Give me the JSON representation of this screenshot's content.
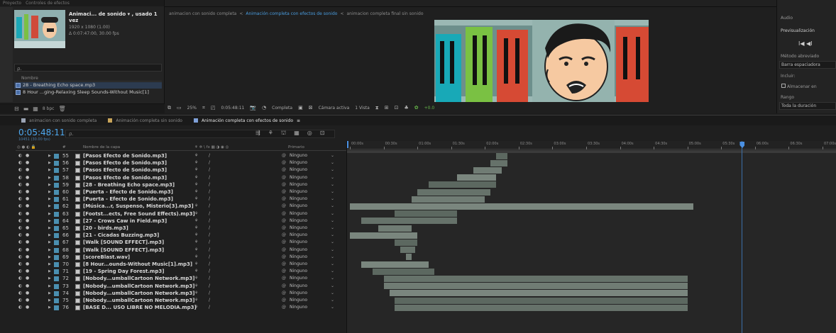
{
  "project": {
    "tabs": [
      "Proyecto",
      "Controles de efectos"
    ],
    "comp_name": "Animaci... de sonido ▾ , usado 1 vez",
    "comp_size": "1920 x 1080 (1.00)",
    "comp_duration": "Δ 0:07:47:00, 30.00 fps",
    "search_placeholder": "",
    "col_header": "Nombre",
    "items": [
      "28 - Breathing Echo space.mp3",
      "8 Hour ...ging-Relaxing Sleep Sounds-Without Music[1]"
    ],
    "bpc": "8 bpc"
  },
  "viewer": {
    "tabs": [
      "animacion con sonido completa",
      "Animación completa con efectos de sonido",
      "animacion completa final sin sonido"
    ],
    "active_tab_index": 1,
    "zoom": "25%",
    "timecode": "0:05:48:11",
    "quality": "Completa",
    "camera": "Cámara activa",
    "views": "1 Vista",
    "exposure": "+0.0"
  },
  "right_panel": {
    "audio": "Audio",
    "preview": "Previsualización",
    "controls": "I◀  ◀I",
    "shortcut_label": "Método abreviado",
    "shortcut_value": "Barra espaciadora",
    "include_label": "Incluir:",
    "cache_label": "Almacenar en",
    "range_label": "Rango",
    "range_value": "Toda la duración"
  },
  "timeline": {
    "tabs": [
      {
        "label": "animacion con sonido completa",
        "color": "#9ba4b5"
      },
      {
        "label": "Animación completa sin sonido",
        "color": "#c9a55a"
      },
      {
        "label": "Animación completa con efectos de sonido",
        "color": "#7fa0d8",
        "active": true
      }
    ],
    "time": "0:05:48:11",
    "time_sub": "10451 (30.00 fps)",
    "search_placeholder": "ρ.",
    "columns": {
      "av": "◎ ● ◐ 🔒",
      "num": "#",
      "name": "Nombre de la capa",
      "switches": "⚘ ✲ \\ fx ▦ ◑ ◉ ◎",
      "parent": "Primario"
    },
    "parent_value": "Ninguno",
    "layers": [
      {
        "num": "55",
        "name": "[Pasos Efecto de Sonido.mp3]"
      },
      {
        "num": "56",
        "name": "[Pasos Efecto de Sonido.mp3]"
      },
      {
        "num": "57",
        "name": "[Pasos Efecto de Sonido.mp3]"
      },
      {
        "num": "58",
        "name": "[Pasos Efecto de Sonido.mp3]"
      },
      {
        "num": "59",
        "name": "[28 - Breathing Echo space.mp3]"
      },
      {
        "num": "60",
        "name": "[Puerta - Efecto de Sonido.mp3]"
      },
      {
        "num": "61",
        "name": "[Puerta - Efecto de Sonido.mp3]"
      },
      {
        "num": "62",
        "name": "[Música...r, Suspenso, Misterio[3].mp3]"
      },
      {
        "num": "63",
        "name": "[Footst...ects, Free Sound Effects).mp3]"
      },
      {
        "num": "64",
        "name": "[27 - Crows Caw in Field.mp3]"
      },
      {
        "num": "65",
        "name": "[20 - birds.mp3]"
      },
      {
        "num": "66",
        "name": "[21 - Cicadas Buzzing.mp3]"
      },
      {
        "num": "67",
        "name": "[Walk [SOUND EFFECT].mp3]"
      },
      {
        "num": "68",
        "name": "[Walk [SOUND EFFECT].mp3]"
      },
      {
        "num": "69",
        "name": "[scoreBlast.wav]"
      },
      {
        "num": "70",
        "name": "[8 Hour...ounds-Without Music[1].mp3]"
      },
      {
        "num": "71",
        "name": "[19 - Spring Day Forest.mp3]"
      },
      {
        "num": "72",
        "name": "[Nobody...umballCartoon Network.mp3]"
      },
      {
        "num": "73",
        "name": "[Nobody...umballCartoon Network.mp3]"
      },
      {
        "num": "74",
        "name": "[Nobody...umballCartoon Network.mp3]"
      },
      {
        "num": "75",
        "name": "[Nobody...umballCartoon Network.mp3]"
      },
      {
        "num": "76",
        "name": "[BASE D... USO LIBRE NO MELODIA.mp3]"
      }
    ],
    "ruler_labels": [
      "00:00s",
      "00:30s",
      "01:00s",
      "01:30s",
      "02:00s",
      "02:30s",
      "03:00s",
      "03:30s",
      "04:00s",
      "04:30s",
      "05:00s",
      "05:30s",
      "06:00s",
      "06:30s",
      "07:00s"
    ],
    "playhead_seconds": 348.4,
    "clips": [
      [
        [
          130,
          140
        ]
      ],
      [
        [
          125,
          140
        ]
      ],
      [
        [
          110,
          135
        ]
      ],
      [
        [
          95,
          130
        ]
      ],
      [
        [
          70,
          130
        ]
      ],
      [
        [
          60,
          125
        ]
      ],
      [
        [
          55,
          120
        ]
      ],
      [
        [
          0,
          305
        ]
      ],
      [
        [
          40,
          95
        ]
      ],
      [
        [
          10,
          95
        ]
      ],
      [
        [
          25,
          55
        ]
      ],
      [
        [
          0,
          60
        ]
      ],
      [
        [
          40,
          60
        ]
      ],
      [
        [
          45,
          58
        ]
      ],
      [
        [
          50,
          55
        ]
      ],
      [
        [
          10,
          70
        ]
      ],
      [
        [
          20,
          75
        ]
      ],
      [
        [
          30,
          300
        ]
      ],
      [
        [
          30,
          300
        ]
      ],
      [
        [
          35,
          300
        ]
      ],
      [
        [
          40,
          300
        ]
      ],
      [
        [
          40,
          300
        ]
      ]
    ],
    "duration_seconds": 467
  }
}
